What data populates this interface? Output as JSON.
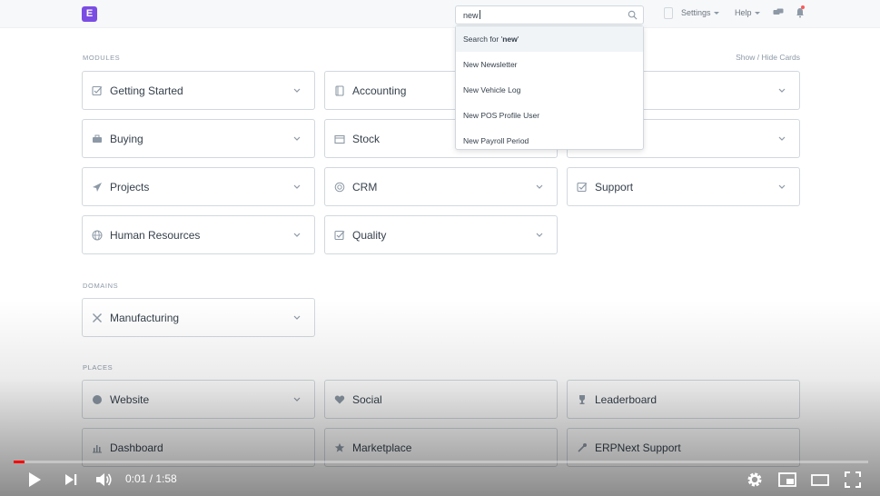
{
  "navbar": {
    "logo_letter": "E",
    "search_value": "new",
    "settings_label": "Settings",
    "help_label": "Help"
  },
  "search_results": [
    {
      "prefix": "Search for '",
      "bold": "new",
      "suffix": "'"
    },
    {
      "label": "New Newsletter"
    },
    {
      "label": "New Vehicle Log"
    },
    {
      "label": "New POS Profile User"
    },
    {
      "label": "New Payroll Period"
    }
  ],
  "sections": {
    "modules": "MODULES",
    "domains": "DOMAINS",
    "places": "PLACES",
    "show_hide": "Show / Hide Cards"
  },
  "modules": [
    {
      "label": "Getting Started",
      "icon": "checkbox-icon"
    },
    {
      "label": "Accounting",
      "icon": "book-icon"
    },
    {
      "label": "",
      "icon": ""
    },
    {
      "label": "Buying",
      "icon": "cart-icon"
    },
    {
      "label": "Stock",
      "icon": "box-icon"
    },
    {
      "label": "",
      "icon": ""
    },
    {
      "label": "Projects",
      "icon": "rocket-icon"
    },
    {
      "label": "CRM",
      "icon": "target-icon"
    },
    {
      "label": "Support",
      "icon": "checkbox-icon"
    },
    {
      "label": "Human Resources",
      "icon": "globe-icon"
    },
    {
      "label": "Quality",
      "icon": "checkbox-icon"
    }
  ],
  "domains": [
    {
      "label": "Manufacturing",
      "icon": "tools-icon"
    }
  ],
  "places": [
    {
      "label": "Website",
      "icon": "globe-icon"
    },
    {
      "label": "Social",
      "icon": "heart-icon"
    },
    {
      "label": "Leaderboard",
      "icon": "trophy-icon"
    },
    {
      "label": "Dashboard",
      "icon": "chart-icon"
    },
    {
      "label": "Marketplace",
      "icon": "star-icon"
    },
    {
      "label": "ERPNext Support",
      "icon": "support-icon"
    }
  ],
  "video": {
    "current_time": "0:01",
    "separator": " / ",
    "duration": "1:58",
    "progress": 0.013,
    "accent": "#ff0000"
  }
}
